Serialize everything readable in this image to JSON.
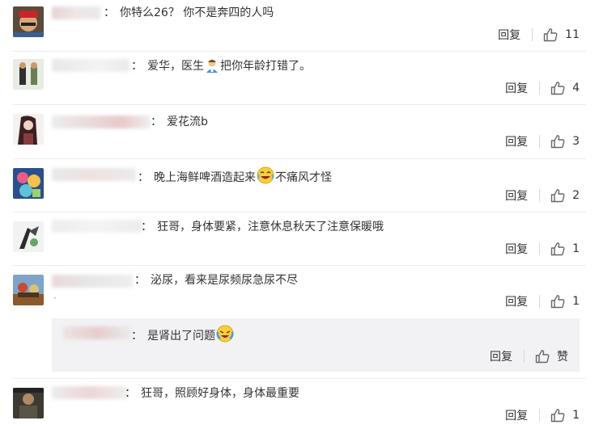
{
  "reply_label": "回复",
  "comments": [
    {
      "text": "你特么26？  你不是奔四的人吗",
      "likes": "11"
    },
    {
      "text_before": "爱华，医生",
      "text_after": "把你年龄打错了。",
      "likes": "4"
    },
    {
      "text": "爱花流b",
      "likes": "3"
    },
    {
      "text_before": "晚上海鲜啤酒造起来",
      "text_after": "不痛风才怪",
      "likes": "2"
    },
    {
      "text": "狂哥，身体要紧，注意休息秋天了注意保暖哦",
      "likes": "1"
    },
    {
      "text": "泌尿，看来是尿频尿急尿不尽",
      "likes": "1"
    },
    {
      "text": "狂哥，照顾好身体，身体最重要",
      "likes": "1"
    }
  ],
  "nested_reply": {
    "text": "是肾出了问题",
    "like_label": "赞"
  },
  "colors": {
    "divider": "#ececec",
    "nested_bg": "#f2f2f5",
    "icon": "#666666"
  },
  "icons": [
    "thumbs-up-icon",
    "doctor-emoji-icon",
    "laughing-emoji-icon",
    "crying-laugh-emoji-icon"
  ]
}
